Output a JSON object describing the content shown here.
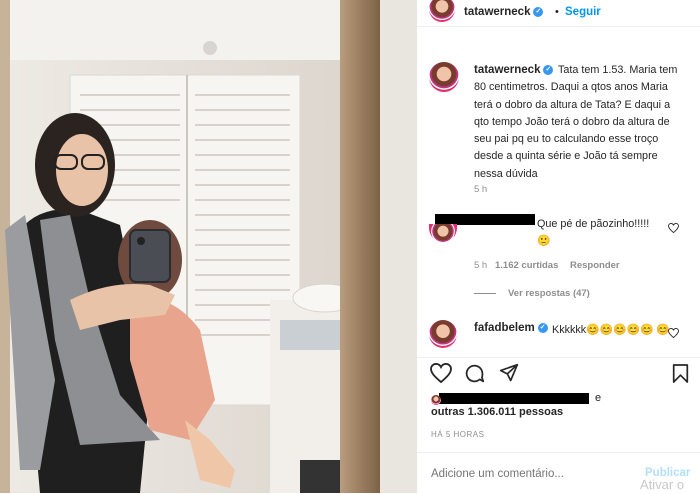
{
  "post": {
    "photo_alt": "photo"
  },
  "header": {
    "username": "tatawerneck",
    "separator": "•",
    "follow_label": "Seguir",
    "more_icon": "more-icon"
  },
  "caption": {
    "username": "tatawerneck",
    "text": "Tata tem 1.53. Maria tem 80 centimetros. Daqui a qtos anos Maria terá o dobro da altura de Tata? E daqui a qto tempo João terá o dobro da altura de seu pai pq eu to calculando esse troço desde a quinta série e João tá sempre nessa dúvida",
    "time": "5 h"
  },
  "comments": [
    {
      "text": "Que pé de pãozinho!!!!! 🙂",
      "time": "5 h",
      "likes": "1.162 curtidas",
      "reply": "Responder",
      "view_replies": "Ver respostas (47)"
    },
    {
      "username": "fafadbelem",
      "text": "Kkkkkk😊😊😊😊😊 😊"
    }
  ],
  "likes": {
    "suffix": "e",
    "others": "outras 1.306.011 pessoas"
  },
  "timestamp": "HÁ 5 HORAS",
  "add_comment": {
    "placeholder": "Adicione um comentário...",
    "publish_label": "Publicar"
  },
  "watermark": "Ativar o"
}
